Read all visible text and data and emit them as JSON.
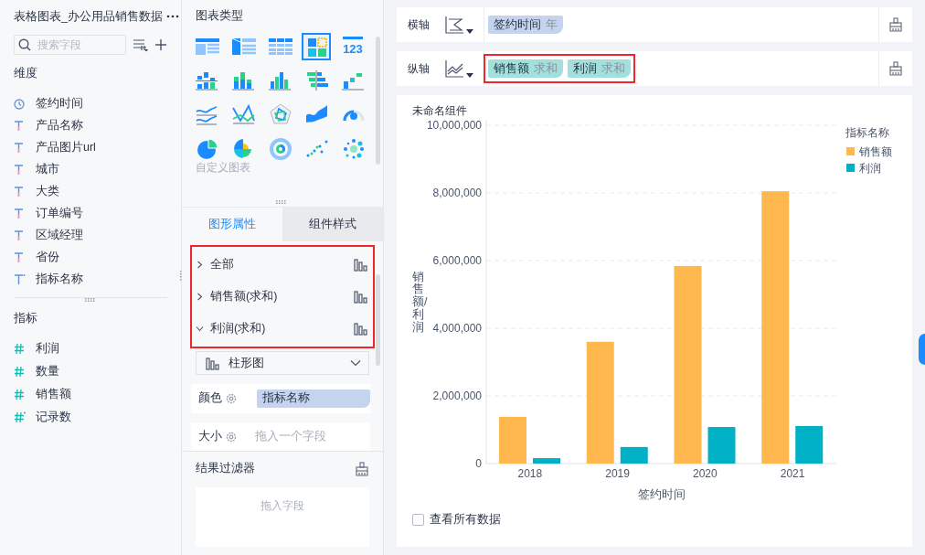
{
  "data_panel": {
    "title": "表格图表_办公用品销售数据",
    "search": {
      "placeholder": "搜索字段"
    },
    "dimensions": {
      "heading": "维度",
      "fields": [
        {
          "name": "签约时间",
          "kind": "time"
        },
        {
          "name": "产品名称",
          "kind": "text"
        },
        {
          "name": "产品图片url",
          "kind": "text"
        },
        {
          "name": "城市",
          "kind": "text"
        },
        {
          "name": "大类",
          "kind": "text"
        },
        {
          "name": "订单编号",
          "kind": "text"
        },
        {
          "name": "区域经理",
          "kind": "text"
        },
        {
          "name": "省份",
          "kind": "text"
        },
        {
          "name": "指标名称",
          "kind": "text-derived"
        }
      ]
    },
    "measures": {
      "heading": "指标",
      "fields": [
        {
          "name": "利润",
          "kind": "number"
        },
        {
          "name": "数量",
          "kind": "number"
        },
        {
          "name": "销售额",
          "kind": "number"
        },
        {
          "name": "记录数",
          "kind": "number-derived"
        }
      ]
    }
  },
  "chart_types": {
    "heading": "图表类型",
    "custom": "自定义图表",
    "types": [
      {
        "kind": "table",
        "selected": false
      },
      {
        "kind": "cross-table",
        "selected": false
      },
      {
        "kind": "detail-table",
        "selected": false
      },
      {
        "kind": "treemap",
        "selected": true
      },
      {
        "kind": "kpi",
        "label": "123",
        "selected": false
      },
      {
        "kind": "stacked-bar",
        "selected": false
      },
      {
        "kind": "grouped-bar",
        "selected": false
      },
      {
        "kind": "bar",
        "selected": false
      },
      {
        "kind": "diverging",
        "selected": false
      },
      {
        "kind": "steps",
        "selected": false
      },
      {
        "kind": "multi-line",
        "selected": false
      },
      {
        "kind": "cross-line",
        "selected": false
      },
      {
        "kind": "radar",
        "selected": false
      },
      {
        "kind": "area",
        "selected": false
      },
      {
        "kind": "gauge",
        "selected": false
      },
      {
        "kind": "pie",
        "selected": false
      },
      {
        "kind": "rose",
        "selected": false
      },
      {
        "kind": "sunburst",
        "selected": false
      },
      {
        "kind": "scatter",
        "selected": false
      },
      {
        "kind": "bubble",
        "selected": false
      }
    ]
  },
  "tabs": [
    {
      "label": "图形属性",
      "selected": true
    },
    {
      "label": "组件样式",
      "selected": false
    }
  ],
  "properties": {
    "highlighted": true,
    "items": [
      {
        "label": "全部",
        "expanded": false
      },
      {
        "label": "销售额(求和)",
        "expanded": false
      },
      {
        "label": "利润(求和)",
        "expanded": true
      }
    ]
  },
  "chart_style": {
    "value": "柱形图"
  },
  "color_field": {
    "label": "颜色",
    "chip": "指标名称"
  },
  "size_field": {
    "label": "大小",
    "placeholder": "拖入一个字段"
  },
  "result_filter": {
    "heading": "结果过滤器",
    "placeholder": "拖入字段"
  },
  "x_axis": {
    "label": "横轴",
    "highlighted": false,
    "chips": [
      {
        "name": "签约时间",
        "agg": "年"
      }
    ]
  },
  "y_axis": {
    "label": "纵轴",
    "highlighted": true,
    "chips": [
      {
        "name": "销售额",
        "agg": "求和"
      },
      {
        "name": "利润",
        "agg": "求和"
      }
    ]
  },
  "chart": {
    "title": "未命名组件",
    "chart_data": {
      "type": "bar",
      "grid": true,
      "legend": {
        "title": "指标名称"
      },
      "xlabel": "签约时间",
      "ylabel": "销售额/利润",
      "categories": [
        "2018",
        "2019",
        "2020",
        "2021"
      ],
      "series": [
        {
          "name": "销售额",
          "color": "#ffb84d",
          "values": [
            1380000,
            3600000,
            5840000,
            8050000
          ]
        },
        {
          "name": "利润",
          "color": "#00b0c5",
          "values": [
            160000,
            490000,
            1080000,
            1110000
          ]
        }
      ],
      "ylim": [
        0,
        10000000
      ],
      "yticks": [
        {
          "value": 0,
          "label": "0"
        },
        {
          "value": 2000000,
          "label": "2,000,000"
        },
        {
          "value": 4000000,
          "label": "4,000,000"
        },
        {
          "value": 6000000,
          "label": "6,000,000"
        },
        {
          "value": 8000000,
          "label": "8,000,000"
        },
        {
          "value": 10000000,
          "label": "10,000,000"
        }
      ]
    }
  },
  "show_all_data": {
    "label": "查看所有数据",
    "checked": false
  }
}
